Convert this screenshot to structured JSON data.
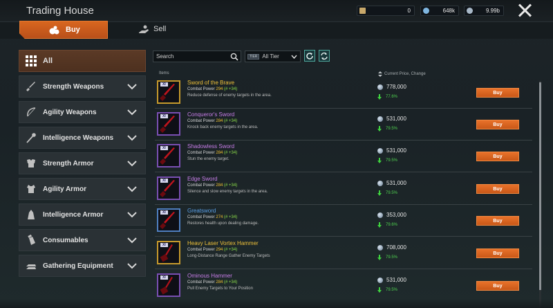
{
  "window": {
    "title": "Trading House",
    "close_icon": "close-icon"
  },
  "currencies": [
    {
      "icon": "silver-ingot-icon",
      "value": "0",
      "color": "#c8a86a"
    },
    {
      "icon": "arrow-token-icon",
      "value": "648k",
      "color": "#7fb6e0"
    },
    {
      "icon": "silver-coin-icon",
      "value": "9.99b",
      "color": "#a8b8c8"
    }
  ],
  "tabs": {
    "buy": "Buy",
    "sell": "Sell"
  },
  "categories": [
    {
      "label": "All",
      "icon": "grid-icon"
    },
    {
      "label": "Strength Weapons",
      "icon": "sword-icon"
    },
    {
      "label": "Agility Weapons",
      "icon": "bow-icon"
    },
    {
      "label": "Intelligence Weapons",
      "icon": "staff-icon"
    },
    {
      "label": "Strength Armor",
      "icon": "heavy-armor-icon"
    },
    {
      "label": "Agility Armor",
      "icon": "light-armor-icon"
    },
    {
      "label": "Intelligence Armor",
      "icon": "robe-icon"
    },
    {
      "label": "Consumables",
      "icon": "potion-icon"
    },
    {
      "label": "Gathering Equipment",
      "icon": "ingot-icon"
    }
  ],
  "filters": {
    "search_placeholder": "Search",
    "tier_badge": "TIER",
    "tier_value": "All Tier"
  },
  "columns": {
    "items": "Items",
    "price": "Current Price, Change"
  },
  "items": [
    {
      "level": "XI",
      "name": "Sword of the Brave",
      "rarity": "gold",
      "name_color": "#f0c23a",
      "cp_label": "Combat Power",
      "cp": "294",
      "cp_delta": "(# +34)",
      "desc": "Reduce defense of enemy targets in the area.",
      "price": "778,000",
      "change": "77.6%",
      "buy": "Buy"
    },
    {
      "level": "XI",
      "name": "Conqueror's Sword",
      "rarity": "purple",
      "name_color": "#c77de8",
      "cp_label": "Combat Power",
      "cp": "284",
      "cp_delta": "(# +34)",
      "desc": "Knock back enemy targets in the area.",
      "price": "531,000",
      "change": "79.5%",
      "buy": "Buy"
    },
    {
      "level": "XI",
      "name": "Shadowless Sword",
      "rarity": "purple",
      "name_color": "#c77de8",
      "cp_label": "Combat Power",
      "cp": "284",
      "cp_delta": "(# +34)",
      "desc": "Stun the enemy target.",
      "price": "531,000",
      "change": "79.5%",
      "buy": "Buy"
    },
    {
      "level": "XI",
      "name": "Edge Sword",
      "rarity": "purple",
      "name_color": "#c77de8",
      "cp_label": "Combat Power",
      "cp": "284",
      "cp_delta": "(# +34)",
      "desc": "Silence and slow enemy targets in the area.",
      "price": "531,000",
      "change": "79.5%",
      "buy": "Buy"
    },
    {
      "level": "XI",
      "name": "Greatsword",
      "rarity": "blue",
      "name_color": "#5aa0e8",
      "cp_label": "Combat Power",
      "cp": "274",
      "cp_delta": "(# +34)",
      "desc": "Restores health upon dealing damage.",
      "price": "353,000",
      "change": "79.6%",
      "buy": "Buy"
    },
    {
      "level": "XI",
      "name": "Heavy Laser Vortex Hammer",
      "rarity": "gold",
      "name_color": "#f0c23a",
      "cp_label": "Combat Power",
      "cp": "294",
      "cp_delta": "(# +34)",
      "desc": "Long-Distance Range Gather Enemy Targets",
      "price": "708,000",
      "change": "79.5%",
      "buy": "Buy"
    },
    {
      "level": "XI",
      "name": "Ominous Hammer",
      "rarity": "purple",
      "name_color": "#c77de8",
      "cp_label": "Combat Power",
      "cp": "284",
      "cp_delta": "(# +34)",
      "desc": "Pull Enemy Targets to Your Position",
      "price": "531,000",
      "change": "79.5%",
      "buy": "Buy"
    }
  ]
}
